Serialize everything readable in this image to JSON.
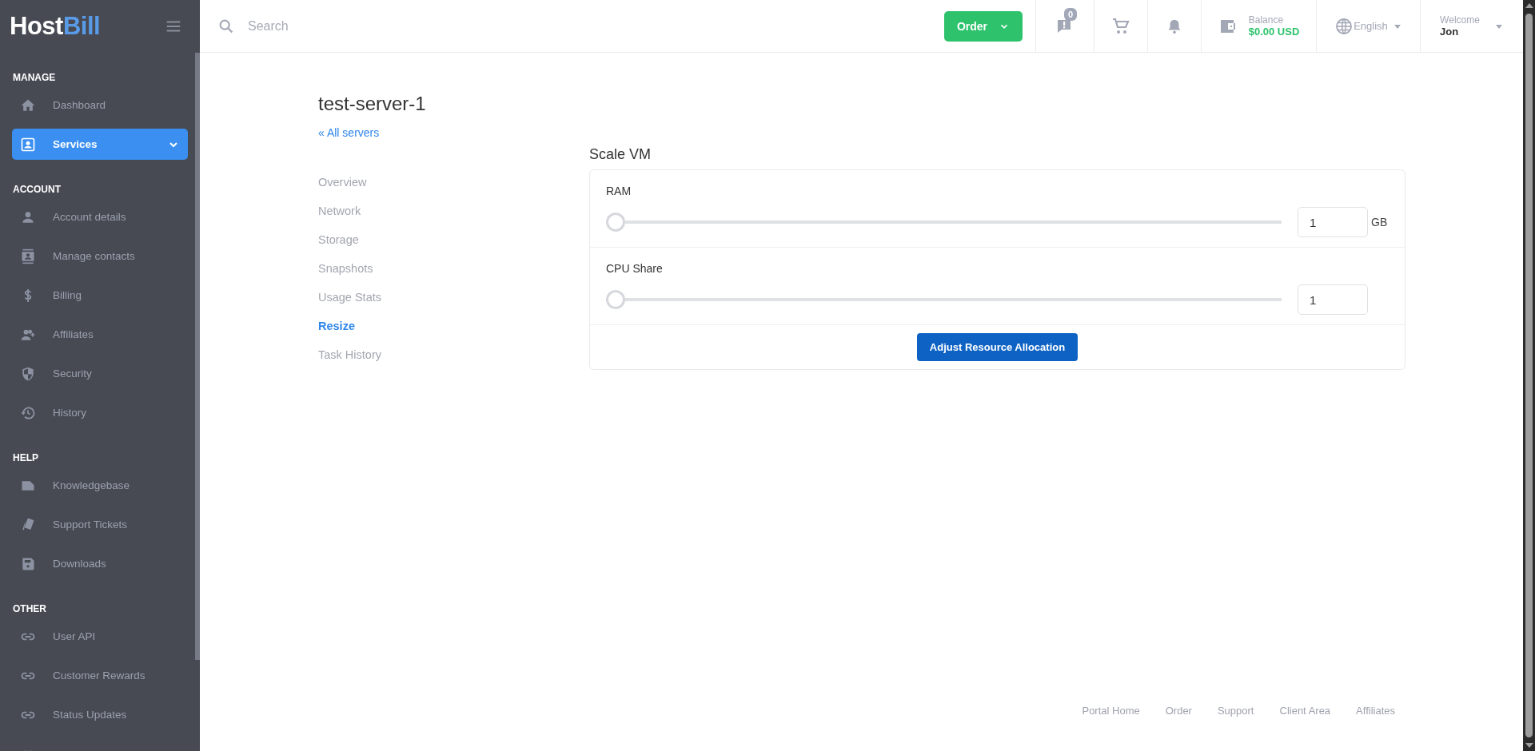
{
  "sidebar": {
    "logo": {
      "part_1": "Host",
      "part_2": "Bill"
    },
    "sections": [
      {
        "heading": "MANAGE",
        "items": [
          {
            "label": "Dashboard",
            "kind": "home",
            "selected": false,
            "submenu": false
          },
          {
            "label": "Services",
            "kind": "services",
            "selected": true,
            "submenu": true
          }
        ]
      },
      {
        "heading": "ACCOUNT",
        "items": [
          {
            "label": "Account details",
            "kind": "person",
            "selected": false,
            "submenu": false
          },
          {
            "label": "Manage contacts",
            "kind": "contacts",
            "selected": false,
            "submenu": false
          },
          {
            "label": "Billing",
            "kind": "dollar",
            "selected": false,
            "submenu": false
          },
          {
            "label": "Affiliates",
            "kind": "affiliates",
            "selected": false,
            "submenu": false
          },
          {
            "label": "Security",
            "kind": "shield",
            "selected": false,
            "submenu": false
          },
          {
            "label": "History",
            "kind": "history",
            "selected": false,
            "submenu": false
          }
        ]
      },
      {
        "heading": "HELP",
        "items": [
          {
            "label": "Knowledgebase",
            "kind": "document",
            "selected": false,
            "submenu": false
          },
          {
            "label": "Support Tickets",
            "kind": "tickets",
            "selected": false,
            "submenu": false
          },
          {
            "label": "Downloads",
            "kind": "floppy",
            "selected": false,
            "submenu": false
          }
        ]
      },
      {
        "heading": "OTHER",
        "items": [
          {
            "label": "User API",
            "kind": "link",
            "selected": false,
            "submenu": false
          },
          {
            "label": "Customer Rewards",
            "kind": "link",
            "selected": false,
            "submenu": false
          },
          {
            "label": "Status Updates",
            "kind": "link",
            "selected": false,
            "submenu": false
          },
          {
            "kind": "link",
            "selected": false,
            "submenu": false
          }
        ]
      }
    ]
  },
  "header": {
    "search": {
      "placeholder": "Search"
    },
    "order_button": "Order",
    "messages_badge": "0",
    "balance": {
      "label": "Balance",
      "amount": "$0.00 USD"
    },
    "language": "English",
    "user": {
      "greeting": "Welcome",
      "name": "Jon"
    }
  },
  "main": {
    "title": "test-server-1",
    "back_link": "« All servers",
    "nav": [
      {
        "label": "Overview",
        "selected": false
      },
      {
        "label": "Network",
        "selected": false
      },
      {
        "label": "Storage",
        "selected": false
      },
      {
        "label": "Snapshots",
        "selected": false
      },
      {
        "label": "Usage Stats",
        "selected": false
      },
      {
        "label": "Resize",
        "selected": true
      },
      {
        "label": "Task History",
        "selected": false
      }
    ],
    "panel": {
      "title": "Scale VM",
      "resources": [
        {
          "label": "RAM",
          "level": 0,
          "value": "1",
          "unit": "GB"
        },
        {
          "label": "CPU Share",
          "level": 0,
          "value": "1"
        }
      ],
      "button": "Adjust Resource Allocation"
    }
  },
  "footer": {
    "links": [
      "Portal Home",
      "Order",
      "Support",
      "Client Area",
      "Affiliates"
    ]
  }
}
